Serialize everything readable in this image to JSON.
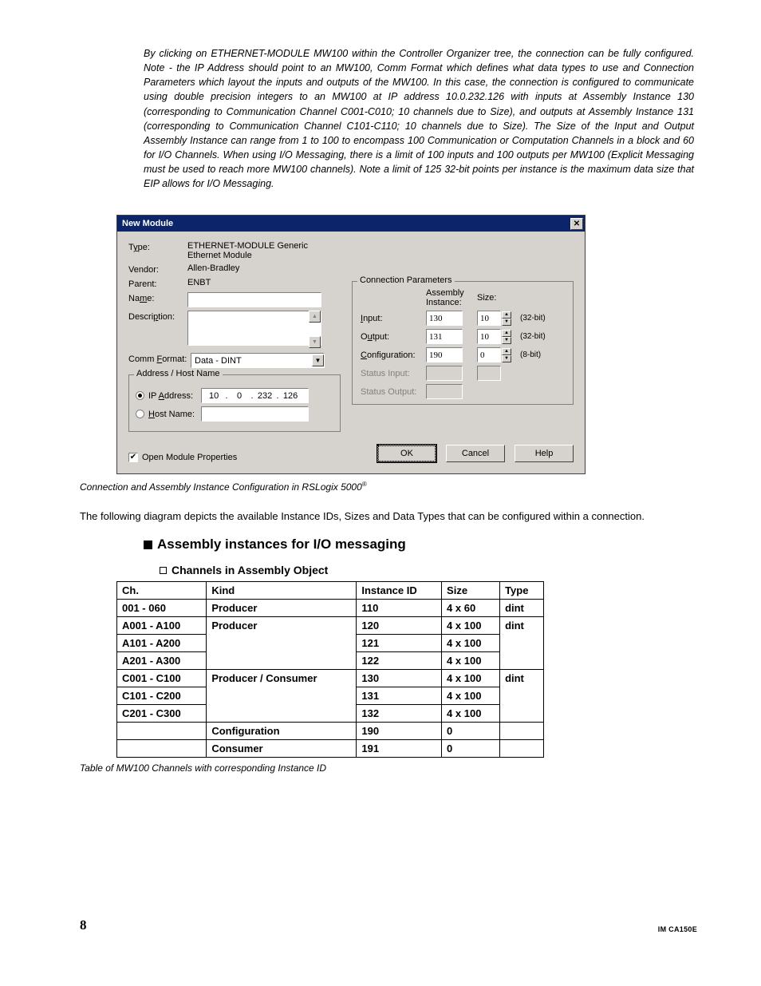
{
  "intro": "By clicking on ETHERNET-MODULE MW100 within the Controller Organizer tree, the connection can be fully configured.  Note - the IP Address should point to an MW100, Comm Format which defines what data types to use and Connection Parameters which layout the inputs and outputs of the MW100.  In this case, the connection is configured to communicate using double precision integers to an MW100 at IP address 10.0.232.126 with inputs at Assembly Instance 130 (corresponding to Communication Channel C001-C010; 10 channels due to Size), and outputs at Assembly Instance 131 (corresponding to Communication Channel C101-C110; 10 channels due to Size).  The Size of the Input and Output Assembly Instance can range from 1 to 100 to encompass 100 Communication or Computation Channels in a block and 60 for I/O Channels.  When using I/O Messaging, there is a limit of 100 inputs and 100 outputs per MW100 (Explicit Messaging must be used to reach more MW100 channels).  Note a limit of 125 32-bit points per instance is the maximum data size that EIP allows for I/O Messaging.",
  "dialog": {
    "title": "New Module",
    "type_label": "Type:",
    "type_value": "ETHERNET-MODULE Generic Ethernet Module",
    "vendor_label": "Vendor:",
    "vendor_value": "Allen-Bradley",
    "parent_label": "Parent:",
    "parent_value": "ENBT",
    "name_label": "Name:",
    "name_value": "",
    "desc_label": "Description:",
    "desc_value": "",
    "comm_label": "Comm Format:",
    "comm_value": "Data - DINT",
    "addr_group": "Address / Host Name",
    "ip_label": "IP Address:",
    "ip": [
      "10",
      "0",
      "232",
      "126"
    ],
    "host_label": "Host Name:",
    "host_value": "",
    "cp_group": "Connection Parameters",
    "cp_assembly_hdr": "Assembly\nInstance:",
    "cp_size_hdr": "Size:",
    "rows": {
      "input": {
        "label": "Input:",
        "inst": "130",
        "size": "10",
        "bits": "(32-bit)"
      },
      "output": {
        "label": "Output:",
        "inst": "131",
        "size": "10",
        "bits": "(32-bit)"
      },
      "config": {
        "label": "Configuration:",
        "inst": "190",
        "size": "0",
        "bits": "(8-bit)"
      },
      "status_in": {
        "label": "Status Input:",
        "inst": "",
        "size": "",
        "bits": ""
      },
      "status_out": {
        "label": "Status Output:",
        "inst": "",
        "size": "",
        "bits": ""
      }
    },
    "open_props": "Open Module Properties",
    "ok": "OK",
    "cancel": "Cancel",
    "help": "Help"
  },
  "dialog_caption": "Connection and Assembly Instance Configuration in RSLogix 5000",
  "following": "The following diagram depicts the available Instance IDs, Sizes and Data Types that can be configured within a connection.",
  "heading_asm": "Assembly instances for I/O messaging",
  "heading_ch": "Channels in Assembly Object",
  "table": {
    "headers": [
      "Ch.",
      "Kind",
      "Instance ID",
      "Size",
      "Type"
    ],
    "rows": [
      {
        "ch": "001 - 060",
        "kind": "Producer",
        "id": "110",
        "size": "4 x 60",
        "type": "dint"
      },
      {
        "ch": "A001 - A100",
        "kind": "Producer",
        "id": "120",
        "size": "4 x 100",
        "type": "dint"
      },
      {
        "ch": "A101 - A200",
        "kind": "",
        "id": "121",
        "size": "4 x 100",
        "type": ""
      },
      {
        "ch": "A201 - A300",
        "kind": "",
        "id": "122",
        "size": "4 x 100",
        "type": ""
      },
      {
        "ch": "C001 - C100",
        "kind": "Producer / Consumer",
        "id": "130",
        "size": "4 x 100",
        "type": "dint"
      },
      {
        "ch": "C101 - C200",
        "kind": "",
        "id": "131",
        "size": "4 x 100",
        "type": ""
      },
      {
        "ch": "C201 - C300",
        "kind": "",
        "id": "132",
        "size": "4 x 100",
        "type": ""
      },
      {
        "ch": "",
        "kind": "Configuration",
        "id": "190",
        "size": "0",
        "type": ""
      },
      {
        "ch": "",
        "kind": "Consumer",
        "id": "191",
        "size": "0",
        "type": ""
      }
    ]
  },
  "table_caption": "Table of MW100 Channels with corresponding Instance ID",
  "footer": {
    "page": "8",
    "docid": "IM CA150E"
  }
}
